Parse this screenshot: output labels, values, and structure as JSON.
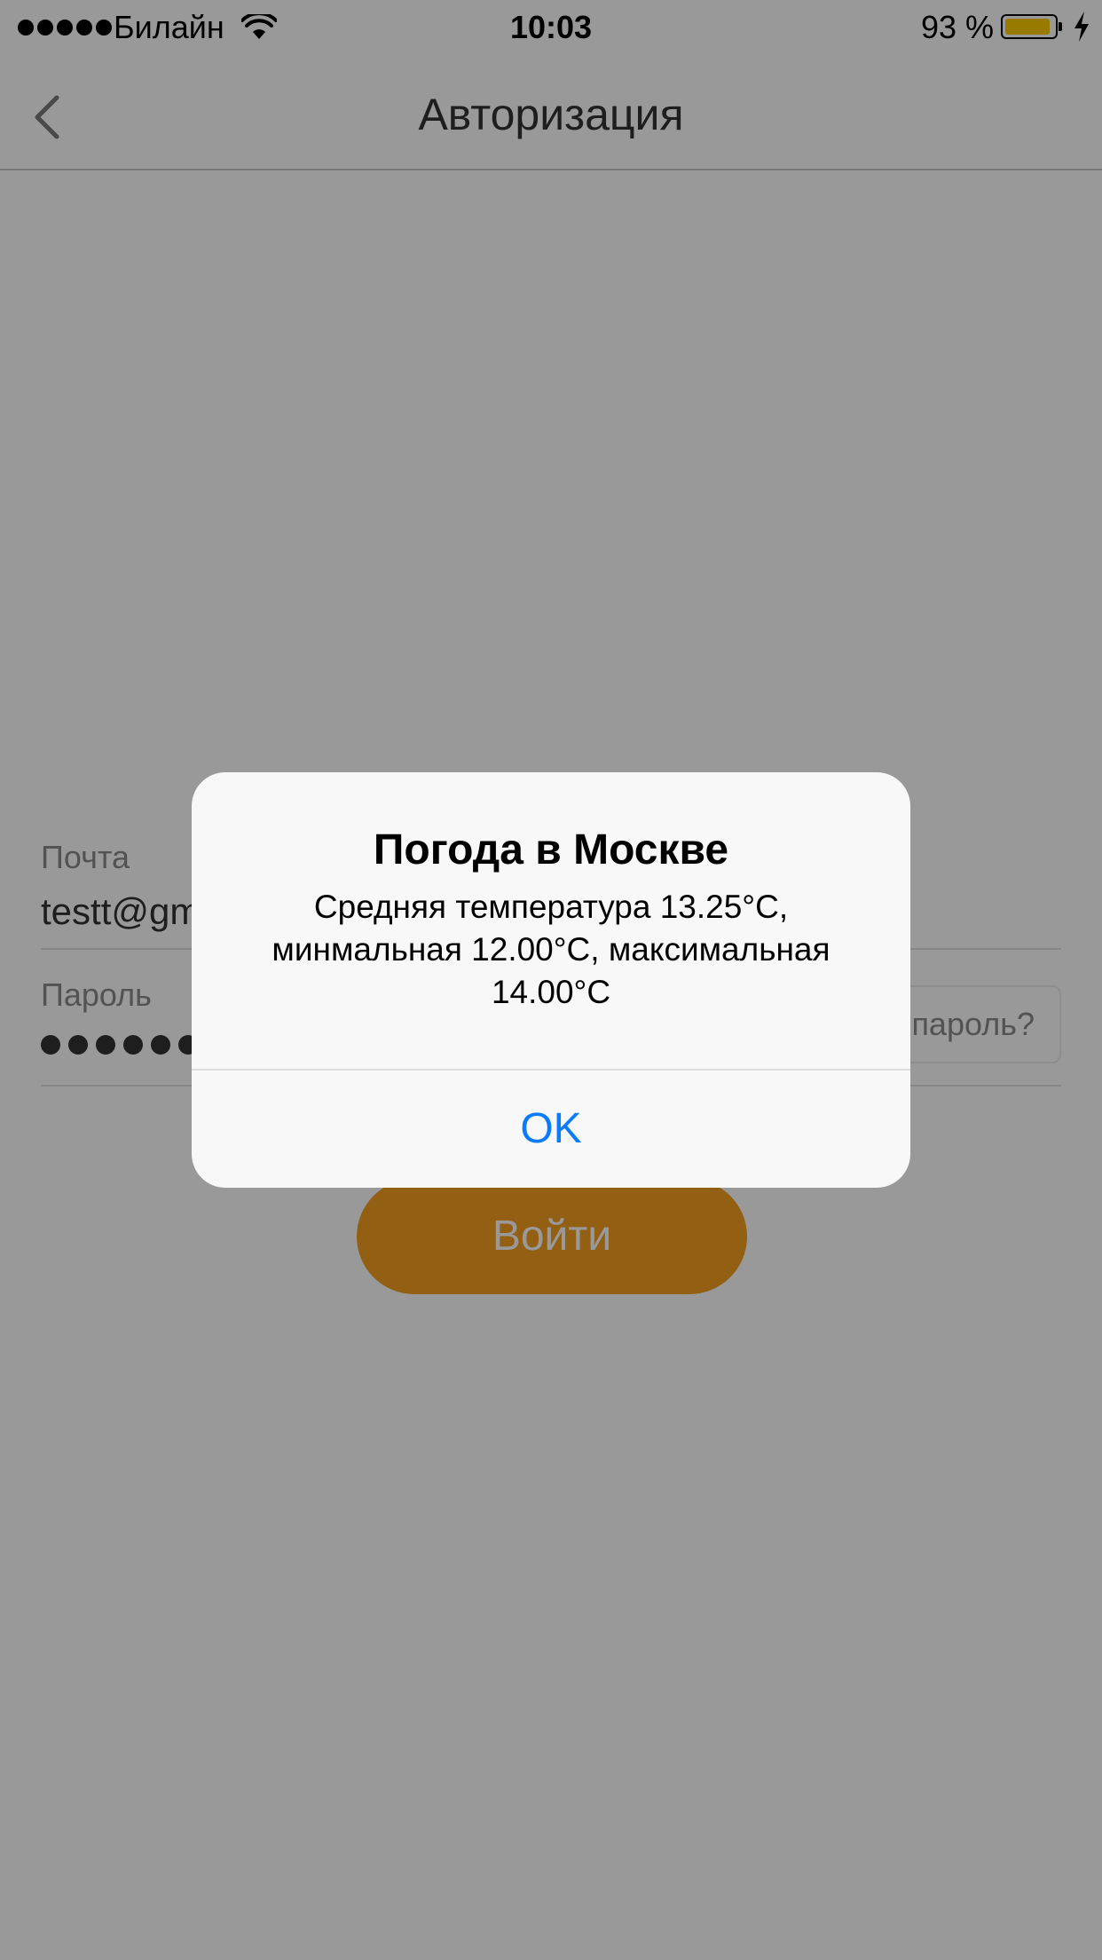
{
  "status_bar": {
    "carrier": "Билайн",
    "time": "10:03",
    "battery_percent": "93 %",
    "battery_level": 0.93,
    "battery_color": "#ffcc00",
    "icons": [
      "signal-icon",
      "wifi-icon",
      "battery-icon",
      "charging-bolt-icon"
    ]
  },
  "nav": {
    "title": "Авторизация",
    "back_icon": "chevron-left-icon"
  },
  "form": {
    "email_label": "Почта",
    "email_value": "testt@gmail.com",
    "password_label": "Пароль",
    "password_dot_count": 8,
    "forgot_label": "Забыли пароль?",
    "login_label": "Войти",
    "login_color": "#f59e20"
  },
  "alert": {
    "title": "Погода в Москве",
    "message": "Средняя температура 13.25°C, минмальная 12.00°C, максимальная 14.00°C",
    "ok_label": "OK",
    "ok_color": "#0a7aff"
  },
  "overlay_color": "#000000"
}
